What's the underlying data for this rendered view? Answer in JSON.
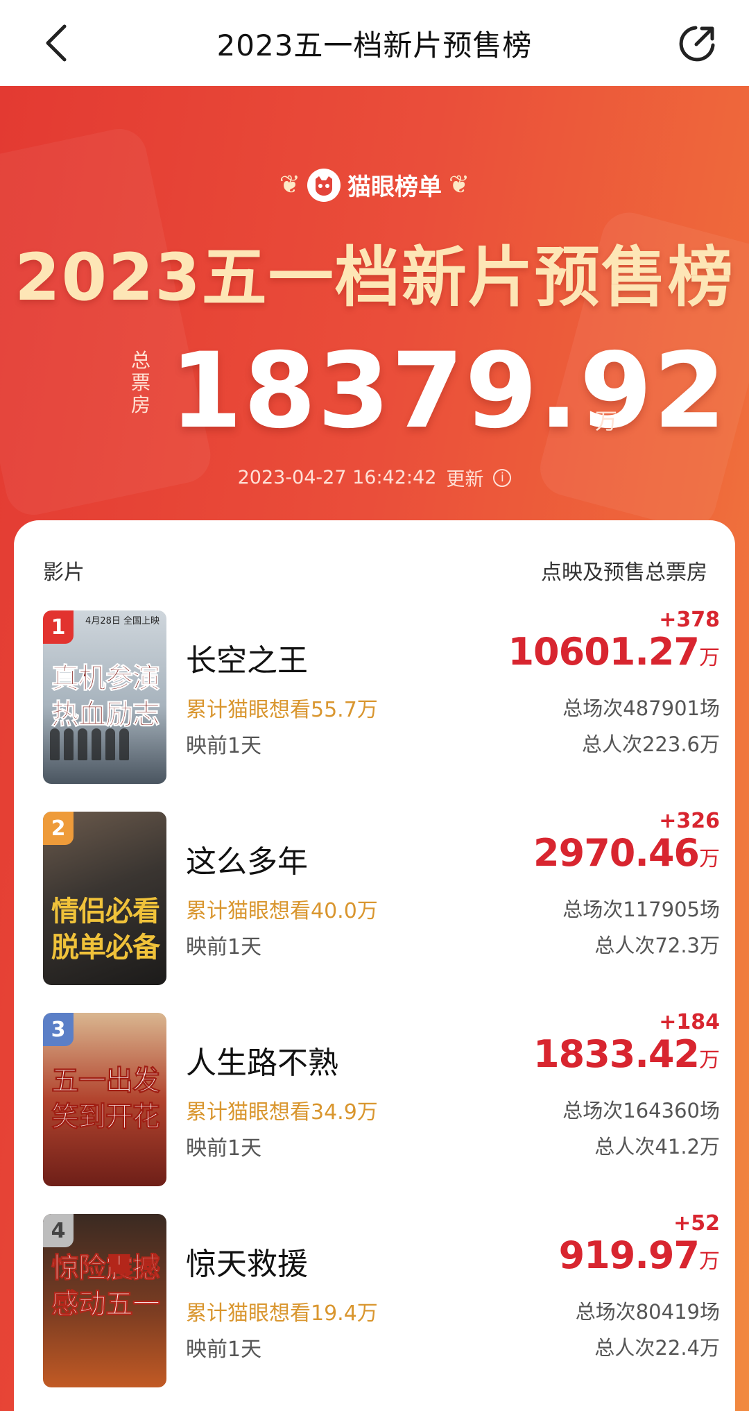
{
  "nav": {
    "title": "2023五一档新片预售榜"
  },
  "hero": {
    "brand": "猫眼榜单",
    "title": "2023五一档新片预售榜",
    "total_label": "总票房",
    "total_value": "18379.92",
    "total_unit": "万",
    "update_time": "2023-04-27  16:42:42",
    "update_label": "更新"
  },
  "table": {
    "col_film": "影片",
    "col_box": "点映及预售总票房",
    "rows": [
      {
        "rank": "1",
        "name": "长空之王",
        "want": "累计猫眼想看55.7万",
        "days": "映前1天",
        "delta": "+378",
        "box": "10601.27",
        "unit": "万",
        "shows": "总场次487901场",
        "people": "总人次223.6万",
        "poster_text": "真机参演热血励志",
        "poster_date": "4月28日 全国上映"
      },
      {
        "rank": "2",
        "name": "这么多年",
        "want": "累计猫眼想看40.0万",
        "days": "映前1天",
        "delta": "+326",
        "box": "2970.46",
        "unit": "万",
        "shows": "总场次117905场",
        "people": "总人次72.3万",
        "poster_text": "情侣必看脱单必备",
        "poster_date": ""
      },
      {
        "rank": "3",
        "name": "人生路不熟",
        "want": "累计猫眼想看34.9万",
        "days": "映前1天",
        "delta": "+184",
        "box": "1833.42",
        "unit": "万",
        "shows": "总场次164360场",
        "people": "总人次41.2万",
        "poster_text": "五一出发笑到开花",
        "poster_date": ""
      },
      {
        "rank": "4",
        "name": "惊天救援",
        "want": "累计猫眼想看19.4万",
        "days": "映前1天",
        "delta": "+52",
        "box": "919.97",
        "unit": "万",
        "shows": "总场次80419场",
        "people": "总人次22.4万",
        "poster_text": "惊险震撼感动五一",
        "poster_date": ""
      }
    ]
  },
  "colors": {
    "accent_red": "#d8252f",
    "want_gold": "#d9962f",
    "hero_title": "#fde6b6"
  }
}
